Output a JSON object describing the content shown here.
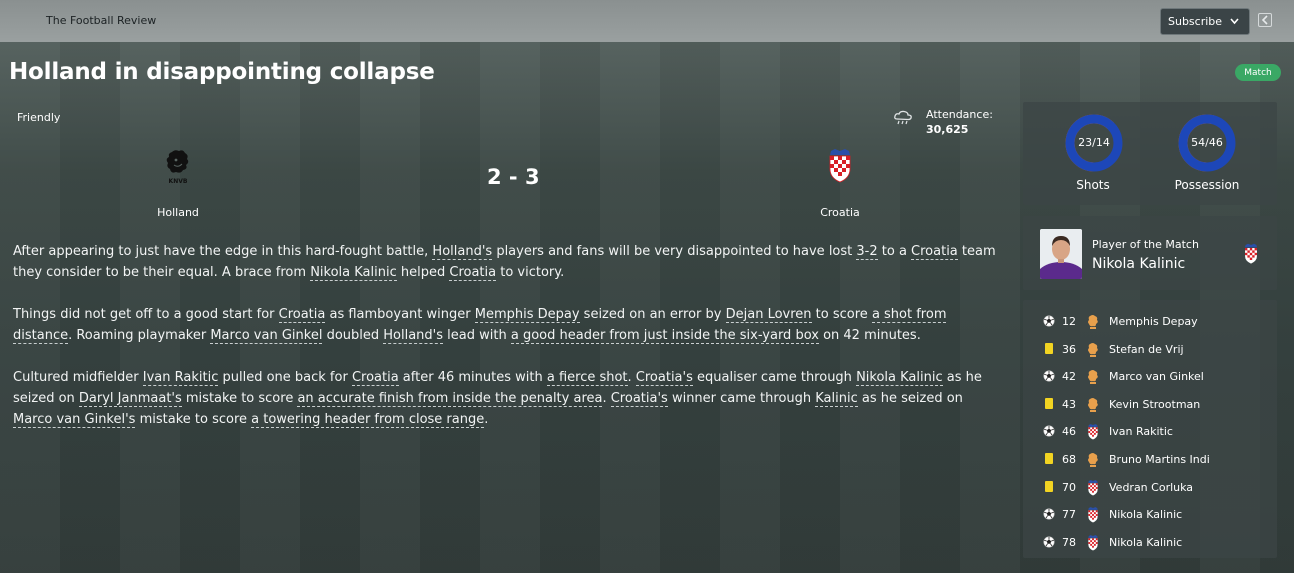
{
  "header": {
    "publication": "The Football Review",
    "subscribe_label": "Subscribe",
    "back_icon": "back-arrow-icon"
  },
  "article": {
    "headline": "Holland in disappointing collapse",
    "badge": "Match",
    "paragraphs": [
      [
        {
          "t": "After appearing to just have the edge in this hard-fought battle, "
        },
        {
          "t": "Holland's",
          "link": true
        },
        {
          "t": " players and fans will be very disappointed to have lost "
        },
        {
          "t": "3-2",
          "link": true
        },
        {
          "t": " to a "
        },
        {
          "t": "Croatia",
          "link": true
        },
        {
          "t": " team they consider to be their equal. A brace from "
        },
        {
          "t": "Nikola Kalinic",
          "link": true
        },
        {
          "t": " helped "
        },
        {
          "t": "Croatia",
          "link": true
        },
        {
          "t": " to victory."
        }
      ],
      [
        {
          "t": "Things did not get off to a good start for "
        },
        {
          "t": "Croatia",
          "link": true
        },
        {
          "t": " as flamboyant winger "
        },
        {
          "t": "Memphis Depay",
          "link": true
        },
        {
          "t": " seized on an error by "
        },
        {
          "t": "Dejan Lovren",
          "link": true
        },
        {
          "t": " to score "
        },
        {
          "t": "a shot from distance",
          "link": true
        },
        {
          "t": ". Roaming playmaker "
        },
        {
          "t": "Marco van Ginkel",
          "link": true
        },
        {
          "t": " doubled "
        },
        {
          "t": "Holland's",
          "link": true
        },
        {
          "t": " lead with "
        },
        {
          "t": "a good header from just inside the six-yard box",
          "link": true
        },
        {
          "t": " on 42 minutes."
        }
      ],
      [
        {
          "t": "Cultured midfielder "
        },
        {
          "t": "Ivan Rakitic",
          "link": true
        },
        {
          "t": " pulled one back for "
        },
        {
          "t": "Croatia",
          "link": true
        },
        {
          "t": " after 46 minutes with "
        },
        {
          "t": "a fierce shot",
          "link": true
        },
        {
          "t": ". "
        },
        {
          "t": "Croatia's",
          "link": true
        },
        {
          "t": " equaliser came through "
        },
        {
          "t": "Nikola Kalinic",
          "link": true
        },
        {
          "t": " as he seized on "
        },
        {
          "t": "Daryl Janmaat's",
          "link": true
        },
        {
          "t": " mistake to score "
        },
        {
          "t": "an accurate finish from inside the penalty area",
          "link": true
        },
        {
          "t": ". "
        },
        {
          "t": "Croatia's",
          "link": true
        },
        {
          "t": " winner came through "
        },
        {
          "t": "Kalinic",
          "link": true
        },
        {
          "t": " as he seized on "
        },
        {
          "t": "Marco van Ginkel's",
          "link": true
        },
        {
          "t": " mistake to score "
        },
        {
          "t": "a towering header from close range",
          "link": true
        },
        {
          "t": "."
        }
      ]
    ]
  },
  "match": {
    "competition": "Friendly",
    "weather_icon": "cloud-rain-icon",
    "attendance_label": "Attendance:",
    "attendance_value": "30,625",
    "home_team": "Holland",
    "away_team": "Croatia",
    "score": "2 - 3",
    "home_logo_icon": "knvb-lion-crest-icon",
    "away_logo_icon": "croatia-checkered-crest-icon"
  },
  "stats": {
    "shots": {
      "label": "Shots",
      "display": "23/14",
      "home": 23,
      "away": 14
    },
    "possession": {
      "label": "Possession",
      "display": "54/46",
      "home": 54,
      "away": 46
    },
    "home_color": "#f46a10",
    "away_color": "#1d47b8"
  },
  "potm": {
    "label": "Player of the Match",
    "name": "Nikola Kalinic"
  },
  "events": [
    {
      "type": "goal",
      "minute": "12",
      "team": "holland",
      "player": "Memphis Depay"
    },
    {
      "type": "yellow",
      "minute": "36",
      "team": "holland",
      "player": "Stefan de Vrij"
    },
    {
      "type": "goal",
      "minute": "42",
      "team": "holland",
      "player": "Marco van Ginkel"
    },
    {
      "type": "yellow",
      "minute": "43",
      "team": "holland",
      "player": "Kevin Strootman"
    },
    {
      "type": "goal",
      "minute": "46",
      "team": "croatia",
      "player": "Ivan Rakitic"
    },
    {
      "type": "yellow",
      "minute": "68",
      "team": "holland",
      "player": "Bruno Martins Indi"
    },
    {
      "type": "yellow",
      "minute": "70",
      "team": "croatia",
      "player": "Vedran Corluka"
    },
    {
      "type": "goal",
      "minute": "77",
      "team": "croatia",
      "player": "Nikola Kalinic"
    },
    {
      "type": "goal",
      "minute": "78",
      "team": "croatia",
      "player": "Nikola Kalinic"
    }
  ]
}
